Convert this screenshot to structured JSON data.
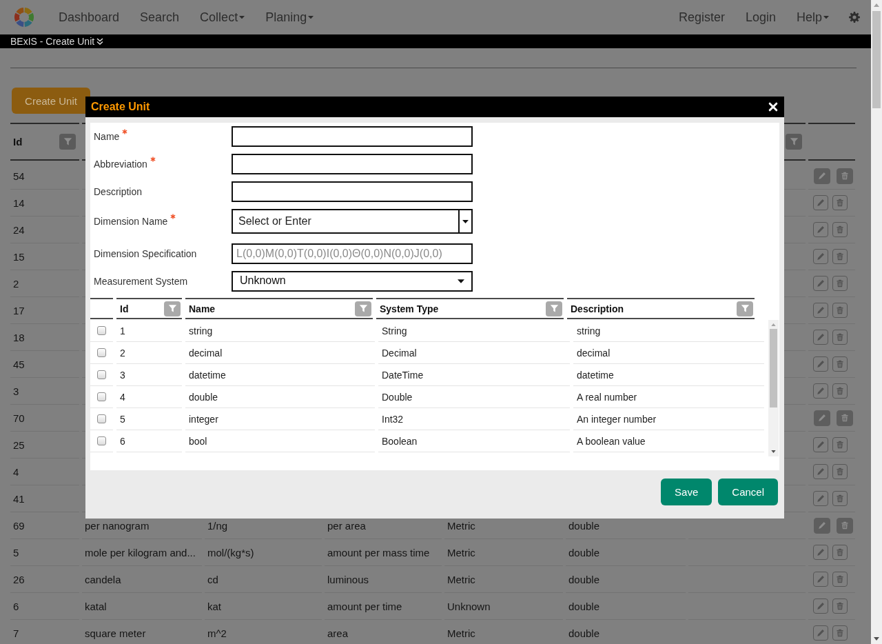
{
  "navbar": {
    "left_items": [
      {
        "label": "Dashboard",
        "dropdown": false
      },
      {
        "label": "Search",
        "dropdown": false
      },
      {
        "label": "Collect",
        "dropdown": true
      },
      {
        "label": "Planing",
        "dropdown": true
      }
    ],
    "right_items": [
      {
        "label": "Register",
        "dropdown": false
      },
      {
        "label": "Login",
        "dropdown": false
      },
      {
        "label": "Help",
        "dropdown": true
      }
    ]
  },
  "breadcrumb": {
    "title": "BExIS - Create Unit"
  },
  "create_button": {
    "label": "Create Unit"
  },
  "units_table": {
    "columns": [
      {
        "label": "Id"
      }
    ],
    "rows": [
      {
        "cells": [
          "54"
        ],
        "actions_disabled": true
      },
      {
        "cells": [
          "14"
        ],
        "actions_disabled": false
      },
      {
        "cells": [
          "24"
        ],
        "actions_disabled": false
      },
      {
        "cells": [
          "15"
        ],
        "actions_disabled": false
      },
      {
        "cells": [
          "2"
        ],
        "actions_disabled": false
      },
      {
        "cells": [
          "17"
        ],
        "actions_disabled": false
      },
      {
        "cells": [
          "18"
        ],
        "actions_disabled": false
      },
      {
        "cells": [
          "45"
        ],
        "actions_disabled": false
      },
      {
        "cells": [
          "3"
        ],
        "actions_disabled": false
      },
      {
        "cells": [
          "70"
        ],
        "actions_disabled": true
      },
      {
        "cells": [
          "25"
        ],
        "actions_disabled": false
      },
      {
        "cells": [
          "4"
        ],
        "actions_disabled": false
      },
      {
        "cells": [
          "41"
        ],
        "actions_disabled": false
      },
      {
        "cells": [
          "69",
          "per nanogram",
          "1/ng",
          "per area",
          "Metric",
          "double"
        ],
        "actions_disabled": true
      },
      {
        "cells": [
          "5",
          "mole per kilogram and...",
          "mol/(kg*s)",
          "amount per mass time",
          "Metric",
          "double"
        ],
        "actions_disabled": false
      },
      {
        "cells": [
          "26",
          "candela",
          "cd",
          "luminous",
          "Metric",
          "double"
        ],
        "actions_disabled": false
      },
      {
        "cells": [
          "6",
          "katal",
          "kat",
          "amount per time",
          "Unknown",
          "double"
        ],
        "actions_disabled": false
      },
      {
        "cells": [
          "7",
          "square meter",
          "m^2",
          "area",
          "Metric",
          "double"
        ],
        "actions_disabled": false
      }
    ]
  },
  "dialog": {
    "title": "Create Unit",
    "fields": [
      {
        "label": "Name",
        "required": true,
        "kind": "text"
      },
      {
        "label": "Abbreviation",
        "required": true,
        "kind": "text"
      },
      {
        "label": "Description",
        "required": false,
        "kind": "text"
      },
      {
        "label": "Dimension Name",
        "required": true,
        "kind": "combobox",
        "placeholder": "Select or Enter"
      },
      {
        "label": "Dimension Specification",
        "required": false,
        "kind": "readonly",
        "placeholder": "L(0,0)M(0,0)T(0,0)I(0,0)Θ(0,0)N(0,0)J(0,0)"
      },
      {
        "label": "Measurement System",
        "required": false,
        "kind": "select",
        "value": "Unknown"
      }
    ],
    "datatype_table": {
      "columns": [
        {
          "label": "Id"
        },
        {
          "label": "Name"
        },
        {
          "label": "System Type"
        },
        {
          "label": "Description"
        }
      ],
      "rows": [
        {
          "checked": false,
          "cells": [
            "1",
            "string",
            "String",
            "string"
          ]
        },
        {
          "checked": false,
          "cells": [
            "2",
            "decimal",
            "Decimal",
            "decimal"
          ]
        },
        {
          "checked": false,
          "cells": [
            "3",
            "datetime",
            "DateTime",
            "datetime"
          ]
        },
        {
          "checked": false,
          "cells": [
            "4",
            "double",
            "Double",
            "A real number"
          ]
        },
        {
          "checked": false,
          "cells": [
            "5",
            "integer",
            "Int32",
            "An integer number"
          ]
        },
        {
          "checked": false,
          "cells": [
            "6",
            "bool",
            "Boolean",
            "A boolean value"
          ]
        }
      ]
    },
    "buttons": [
      {
        "label": "Save"
      },
      {
        "label": "Cancel"
      }
    ]
  }
}
